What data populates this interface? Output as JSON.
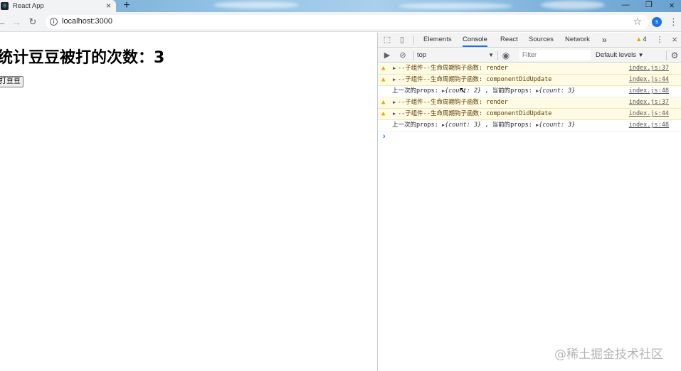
{
  "browser": {
    "tab_title": "React App",
    "url": "localhost:3000",
    "profile_initial": "s"
  },
  "page": {
    "heading": "统计豆豆被打的次数：3",
    "button_label": "打豆豆"
  },
  "devtools": {
    "tabs": [
      "Elements",
      "Console",
      "React",
      "Sources",
      "Network"
    ],
    "active_tab": "Console",
    "more_tabs": "»",
    "warning_count": "4",
    "context": "top",
    "filter_placeholder": "Filter",
    "levels": "Default levels",
    "logs": [
      {
        "level": "warning",
        "message": "--子组件--生命周期钩子函数:  render",
        "source": "index.js:37"
      },
      {
        "level": "warning",
        "message": "--子组件--生命周期钩子函数:  componentDidUpdate",
        "source": "index.js:44"
      },
      {
        "level": "info",
        "prefix": "上一次的props:",
        "prev": "{count: 2}",
        "middle": ", 当前的props:",
        "curr": "{count: 3}",
        "source": "index.js:48"
      },
      {
        "level": "warning",
        "message": "--子组件--生命周期钩子函数:  render",
        "source": "index.js:37"
      },
      {
        "level": "warning",
        "message": "--子组件--生命周期钩子函数:  componentDidUpdate",
        "source": "index.js:44"
      },
      {
        "level": "info",
        "prefix": "上一次的props:",
        "prev": "{count: 3}",
        "middle": ", 当前的props:",
        "curr": "{count: 3}",
        "source": "index.js:48"
      }
    ],
    "prompt": "›"
  },
  "watermark": "@稀土掘金技术社区",
  "colors": {
    "warning_bg": "#fffbe5",
    "warning_icon": "#e8a600",
    "accent": "#1a73e8"
  }
}
